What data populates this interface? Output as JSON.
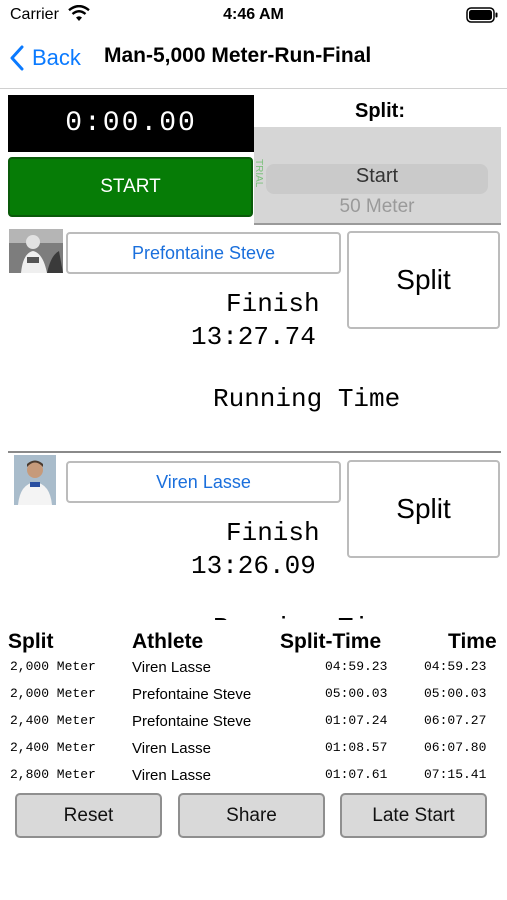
{
  "status": {
    "carrier": "Carrier",
    "time": "4:46 AM"
  },
  "nav": {
    "back_label": "Back",
    "title": "Man-5,000 Meter-Run-Final"
  },
  "timer": {
    "display": "0:00.00",
    "start_label": "START"
  },
  "split_panel": {
    "title": "Split:",
    "side_label": "TRIAL",
    "selected": "Start",
    "next": "50 Meter"
  },
  "athletes": [
    {
      "name": "Prefontaine  Steve",
      "split_label": "Split",
      "finish_label": "Finish",
      "finish_time": "13:27.74",
      "running_label": "Running Time"
    },
    {
      "name": "Viren Lasse",
      "split_label": "Split",
      "finish_label": "Finish",
      "finish_time": "13:26.09",
      "running_label": "Running Ti"
    }
  ],
  "results": {
    "headers": {
      "split": "Split",
      "athlete": "Athlete",
      "split_time": "Split-Time",
      "time": "Time"
    },
    "rows": [
      {
        "split": "2,000 Meter",
        "athlete": "Viren Lasse",
        "split_time": "04:59.23",
        "time": "04:59.23"
      },
      {
        "split": "2,000 Meter",
        "athlete": "Prefontaine  Steve",
        "split_time": "05:00.03",
        "time": "05:00.03"
      },
      {
        "split": "2,400 Meter",
        "athlete": "Prefontaine  Steve",
        "split_time": "01:07.24",
        "time": "06:07.27"
      },
      {
        "split": "2,400 Meter",
        "athlete": "Viren Lasse",
        "split_time": "01:08.57",
        "time": "06:07.80"
      },
      {
        "split": "2,800 Meter",
        "athlete": "Viren Lasse",
        "split_time": "01:07.61",
        "time": "07:15.41"
      }
    ]
  },
  "buttons": {
    "reset": "Reset",
    "share": "Share",
    "late_start": "Late Start"
  },
  "colors": {
    "accent": "#0a7aff",
    "start_green": "#067c06",
    "timer_bg": "#000000"
  }
}
